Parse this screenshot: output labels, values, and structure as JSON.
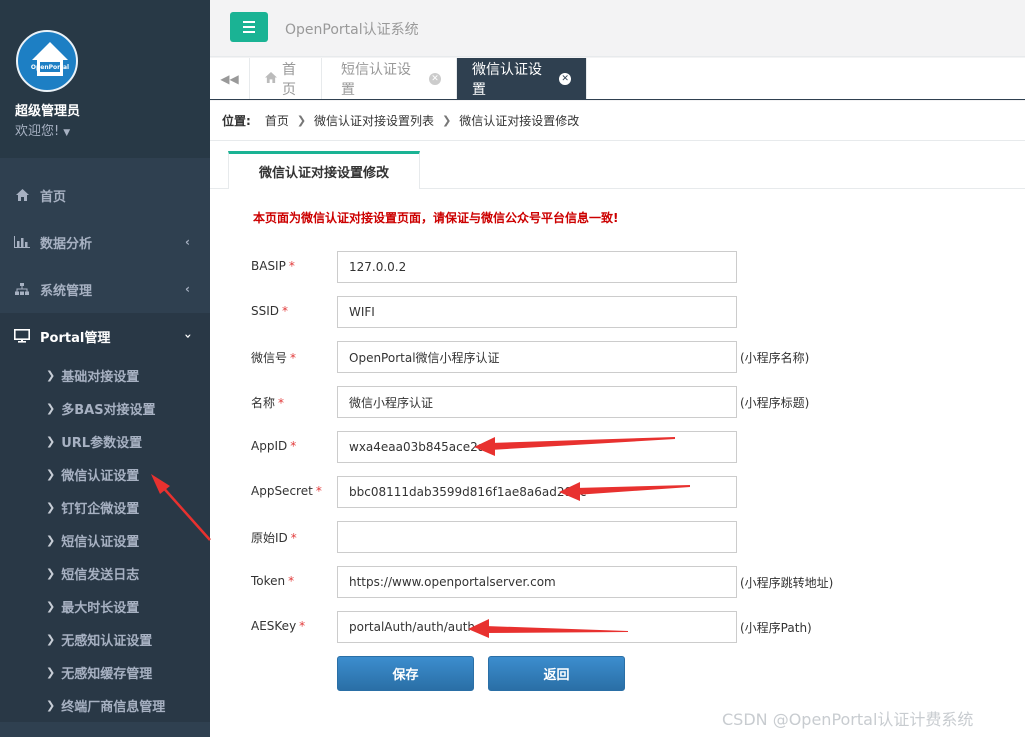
{
  "profile": {
    "name": "超级管理员",
    "welcome": "欢迎您!",
    "logo_text": "OpenPortal"
  },
  "sidebar": {
    "items": [
      {
        "label": "首页",
        "icon": "home-icon"
      },
      {
        "label": "数据分析",
        "icon": "bar-chart-icon"
      },
      {
        "label": "系统管理",
        "icon": "sitemap-icon"
      },
      {
        "label": "Portal管理",
        "icon": "monitor-icon"
      }
    ],
    "sub_items": [
      "基础对接设置",
      "多BAS对接设置",
      "URL参数设置",
      "微信认证设置",
      "钉钉企微设置",
      "短信认证设置",
      "短信发送日志",
      "最大时长设置",
      "无感知认证设置",
      "无感知缓存管理",
      "终端厂商信息管理"
    ]
  },
  "header": {
    "app_title": "OpenPortal认证系统"
  },
  "tabs": [
    {
      "label": "首页",
      "closable": false
    },
    {
      "label": "短信认证设置",
      "closable": true
    },
    {
      "label": "微信认证设置",
      "closable": true,
      "active": true
    }
  ],
  "breadcrumb": {
    "label": "位置:",
    "items": [
      "首页",
      "微信认证对接设置列表",
      "微信认证对接设置修改"
    ]
  },
  "panel": {
    "tab_label": "微信认证对接设置修改",
    "notice": "本页面为微信认证对接设置页面，请保证与微信公众号平台信息一致!"
  },
  "form": {
    "fields": [
      {
        "label": "BASIP",
        "value": "127.0.0.2",
        "hint": ""
      },
      {
        "label": "SSID",
        "value": "WIFI",
        "hint": ""
      },
      {
        "label": "微信号",
        "value": "OpenPortal微信小程序认证",
        "hint": "(小程序名称)"
      },
      {
        "label": "名称",
        "value": "微信小程序认证",
        "hint": "(小程序标题)"
      },
      {
        "label": "AppID",
        "value": "wxa4eaa03b845ace2a",
        "hint": ""
      },
      {
        "label": "AppSecret",
        "value": "bbc08111dab3599d816f1ae8a6ad298c",
        "hint": ""
      },
      {
        "label": "原始ID",
        "value": "",
        "hint": ""
      },
      {
        "label": "Token",
        "value": "https://www.openportalserver.com",
        "hint": "(小程序跳转地址)"
      },
      {
        "label": "AESKey",
        "value": "portalAuth/auth/auth",
        "hint": "(小程序Path)"
      }
    ],
    "required_mark": "*",
    "save_label": "保存",
    "back_label": "返回"
  },
  "watermark": "CSDN @OpenPortal认证计费系统",
  "colors": {
    "sidebar_bg": "#2f4050",
    "accent_green": "#1ab394",
    "button_blue": "#337ab7",
    "notice_red": "#cc0000",
    "arrow_red": "#e8312f"
  }
}
